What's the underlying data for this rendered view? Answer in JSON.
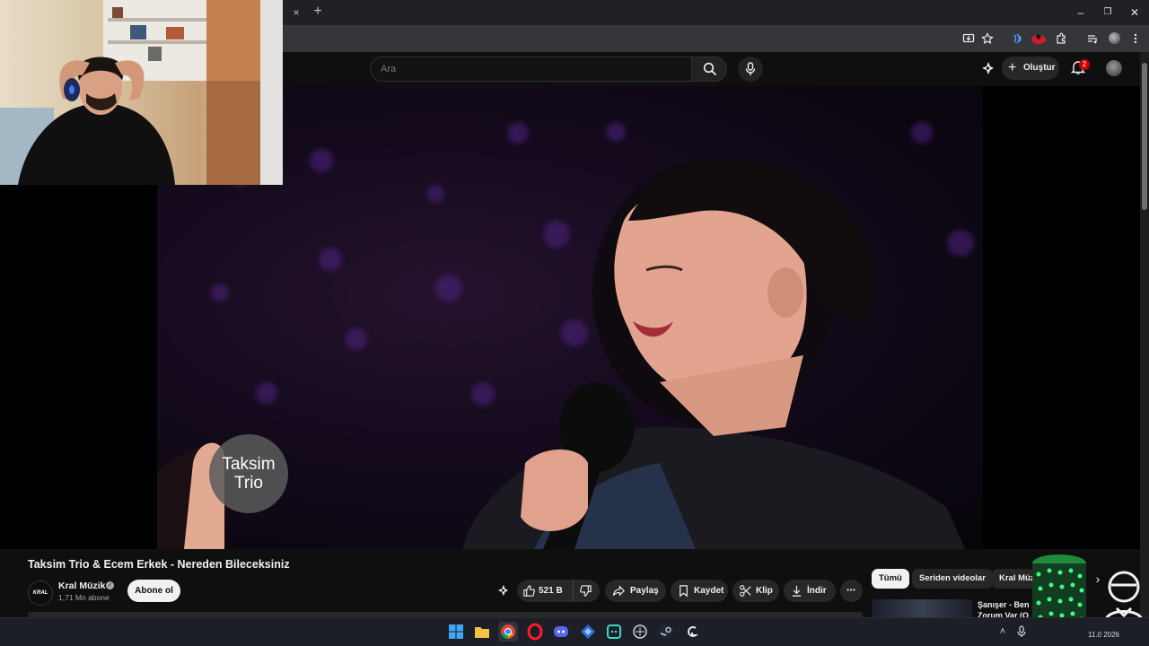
{
  "browser": {
    "tab_close": "×",
    "new_tab": "+",
    "window_controls": [
      "–",
      "❐",
      "✕"
    ],
    "toolbar_icons": [
      "install-icon",
      "star-icon",
      "extension-blue-icon",
      "extension-red-icon",
      "puzzle-icon",
      "media-icon",
      "profile-icon",
      "menu-icon"
    ]
  },
  "youtube": {
    "search": {
      "placeholder": "Ara"
    },
    "create_label": "Oluştur",
    "notifications_count": "2"
  },
  "video": {
    "overlay_logo_line1": "Taksim",
    "overlay_logo_line2": "Trio",
    "title": "Taksim Trio & Ecem Erkek - Nereden Bileceksiniz"
  },
  "channel": {
    "name": "Kral Müzik",
    "avatar_text": "KRAL MÜZİK",
    "subscribers": "1,71 Mn abone",
    "subscribe_label": "Abone ol"
  },
  "actions": {
    "likes": "521 B",
    "share": "Paylaş",
    "save": "Kaydet",
    "clip": "Klip",
    "download": "İndir",
    "more": "•••"
  },
  "chips": [
    "Tümü",
    "Seriden videolar",
    "Kral Müzik"
  ],
  "recommendation": {
    "title_line1": "Şanışer - Ben",
    "title_line2": "Zorum Var (O"
  },
  "taskbar": {
    "apps": [
      "windows-start",
      "file-explorer",
      "chrome",
      "opera",
      "discord",
      "app-blue",
      "app-teal",
      "steam-ring",
      "steam",
      "app-g"
    ],
    "clock": "11.0 2026"
  },
  "colors": {
    "background": "#0f0f0f",
    "accent_red": "#cc0000",
    "chip_active": "#f1f1f1"
  }
}
